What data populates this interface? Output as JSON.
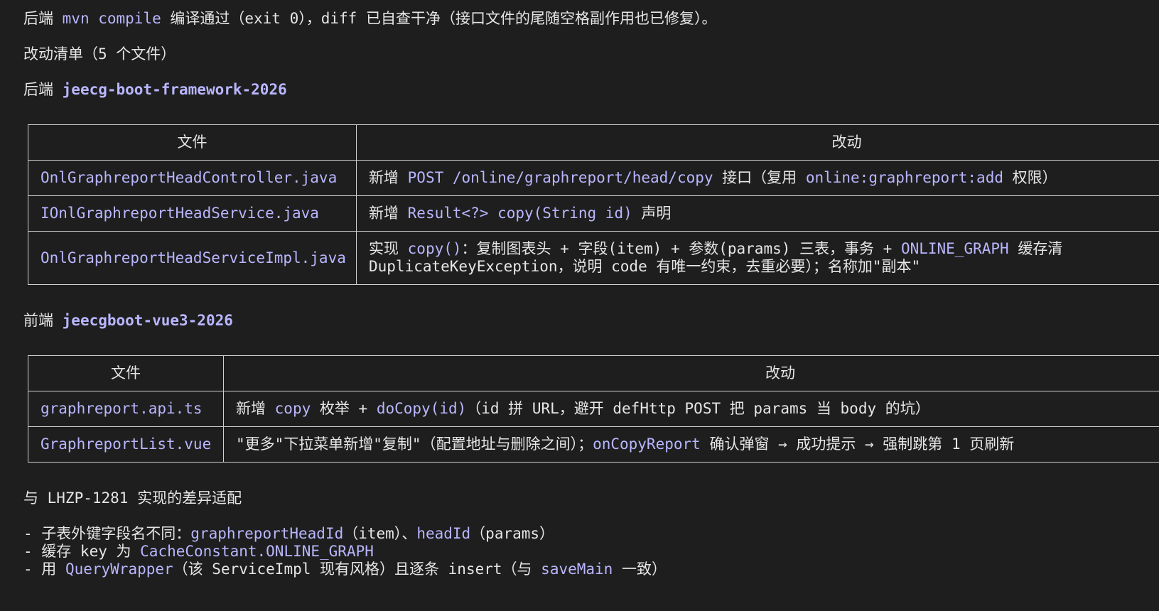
{
  "summary_line": {
    "p1": "后端 ",
    "code1": "mvn compile",
    "p2": " 编译通过（exit 0），diff 已自查干净（接口文件的尾随空格副作用也已修复）。"
  },
  "changes_heading": "改动清单（5 个文件）",
  "backend": {
    "prefix": "后端 ",
    "repo": "jeecg-boot-framework-2026",
    "table": {
      "headers": [
        "文件",
        "改动"
      ],
      "rows": [
        {
          "file": "OnlGraphreportHeadController.java",
          "change": [
            {
              "t": "新增 "
            },
            {
              "c": "POST /online/graphreport/head/copy"
            },
            {
              "t": " 接口（复用 "
            },
            {
              "c": "online:graphreport:add"
            },
            {
              "t": " 权限）"
            }
          ]
        },
        {
          "file": "IOnlGraphreportHeadService.java",
          "change": [
            {
              "t": "新增 "
            },
            {
              "c": "Result<?> copy(String id)"
            },
            {
              "t": " 声明"
            }
          ]
        },
        {
          "file": "OnlGraphreportHeadServiceImpl.java",
          "change_line1": [
            {
              "t": "实现 "
            },
            {
              "c": "copy()"
            },
            {
              "t": "：复制图表头 + 字段(item) + 参数(params) 三表，事务 + "
            },
            {
              "c": "ONLINE_GRAPH"
            },
            {
              "t": " 缓存清"
            }
          ],
          "change_line2": [
            {
              "t": "DuplicateKeyException，说明 code 有唯一约束，去重必要）；名称加\"副本\""
            }
          ]
        }
      ]
    }
  },
  "frontend": {
    "prefix": "前端 ",
    "repo": "jeecgboot-vue3-2026",
    "table": {
      "headers": [
        "文件",
        "改动"
      ],
      "rows": [
        {
          "file": "graphreport.api.ts",
          "change": [
            {
              "t": "新增 "
            },
            {
              "c": "copy"
            },
            {
              "t": " 枚举 + "
            },
            {
              "c": "doCopy(id)"
            },
            {
              "t": "（id 拼 URL，避开 defHttp POST 把 params 当 body 的坑）"
            }
          ]
        },
        {
          "file": "GraphreportList.vue",
          "change": [
            {
              "t": "\"更多\"下拉菜单新增\"复制\"（配置地址与删除之间）；"
            },
            {
              "c": "onCopyReport"
            },
            {
              "t": " 确认弹窗 → 成功提示 → 强制跳第 1 页刷新"
            }
          ]
        }
      ]
    }
  },
  "diff_heading": "与 LHZP-1281 实现的差异适配",
  "diff_items": [
    [
      {
        "t": "- 子表外键字段名不同："
      },
      {
        "c": "graphreportHeadId"
      },
      {
        "t": "（item）、"
      },
      {
        "c": "headId"
      },
      {
        "t": "（params）"
      }
    ],
    [
      {
        "t": "- 缓存 key 为 "
      },
      {
        "c": "CacheConstant.ONLINE_GRAPH"
      }
    ],
    [
      {
        "t": "- 用 "
      },
      {
        "c": "QueryWrapper"
      },
      {
        "t": "（该 ServiceImpl 现有风格）且逐条 insert（与 "
      },
      {
        "c": "saveMain"
      },
      {
        "t": " 一致）"
      }
    ]
  ],
  "colors": {
    "background": "#1e1e1e",
    "text": "#e6e6e6",
    "code_highlight": "#b9b6ff",
    "table_border": "#d0d0d0"
  }
}
